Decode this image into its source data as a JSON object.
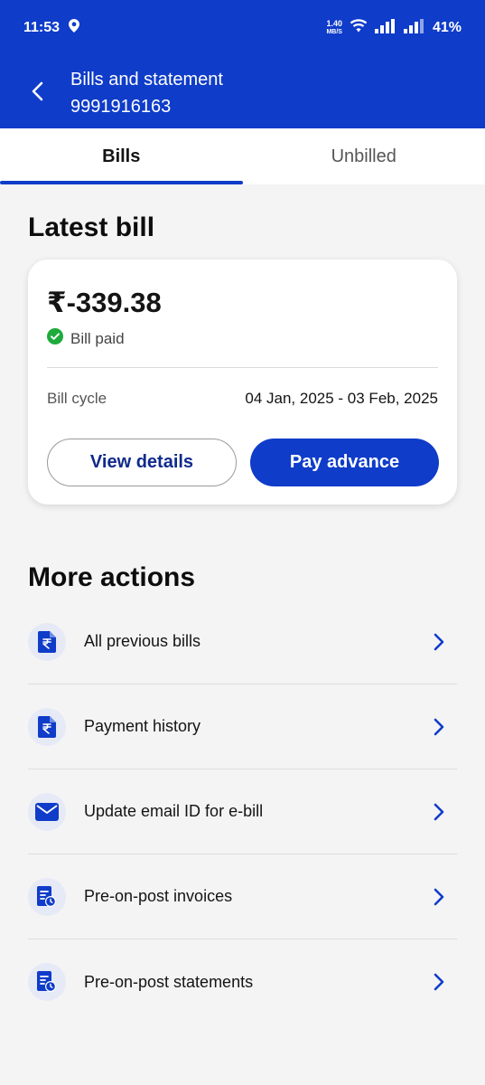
{
  "status_bar": {
    "time": "11:53",
    "net_speed_value": "1.40",
    "net_speed_unit": "MB/S",
    "battery": "41%"
  },
  "header": {
    "title": "Bills and statement",
    "number": "9991916163"
  },
  "tabs": [
    {
      "label": "Bills",
      "active": true
    },
    {
      "label": "Unbilled",
      "active": false
    }
  ],
  "latest_bill": {
    "section_title": "Latest bill",
    "amount": "₹-339.38",
    "status": "Bill paid",
    "cycle_label": "Bill cycle",
    "cycle_value": "04 Jan, 2025 - 03 Feb, 2025",
    "view_details_label": "View details",
    "pay_advance_label": "Pay advance"
  },
  "more_actions": {
    "section_title": "More actions",
    "items": [
      {
        "label": "All previous bills",
        "icon": "rupee-document-icon"
      },
      {
        "label": "Payment history",
        "icon": "rupee-document-icon"
      },
      {
        "label": "Update email ID for e-bill",
        "icon": "envelope-icon"
      },
      {
        "label": "Pre-on-post invoices",
        "icon": "invoice-clock-icon"
      },
      {
        "label": "Pre-on-post statements",
        "icon": "statement-clock-icon"
      }
    ]
  },
  "colors": {
    "brand_blue": "#0f3cc9",
    "success_green": "#1faa3c"
  }
}
